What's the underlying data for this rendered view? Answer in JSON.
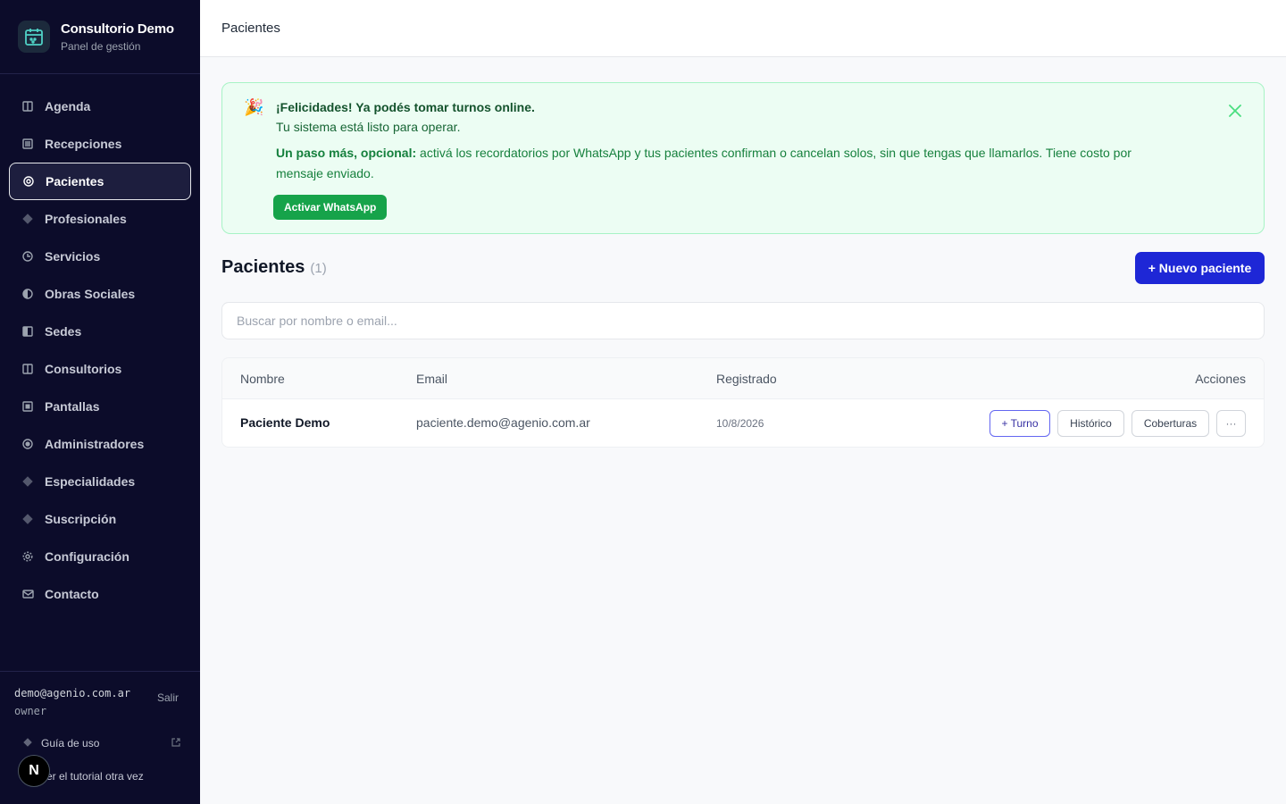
{
  "brand": {
    "title": "Consultorio Demo",
    "subtitle": "Panel de gestión"
  },
  "sidebar": {
    "items": [
      {
        "label": "Agenda",
        "icon": "columns-icon"
      },
      {
        "label": "Recepciones",
        "icon": "list-icon"
      },
      {
        "label": "Pacientes",
        "icon": "target-icon",
        "active": true
      },
      {
        "label": "Profesionales",
        "icon": "diamond-icon"
      },
      {
        "label": "Servicios",
        "icon": "clock-icon"
      },
      {
        "label": "Obras Sociales",
        "icon": "half-circle-icon"
      },
      {
        "label": "Sedes",
        "icon": "half-square-icon"
      },
      {
        "label": "Consultorios",
        "icon": "columns-icon"
      },
      {
        "label": "Pantallas",
        "icon": "screen-icon"
      },
      {
        "label": "Administradores",
        "icon": "record-icon"
      },
      {
        "label": "Especialidades",
        "icon": "diamond-icon"
      },
      {
        "label": "Suscripción",
        "icon": "diamond-icon"
      },
      {
        "label": "Configuración",
        "icon": "gear-icon"
      },
      {
        "label": "Contacto",
        "icon": "mail-icon"
      }
    ]
  },
  "user": {
    "email": "demo@agenio.com.ar",
    "role": "owner",
    "logout": "Salir"
  },
  "footer": {
    "guide": "Guía de uso",
    "tutorial": "er el tutorial otra vez",
    "badge": "N"
  },
  "topbar": {
    "title": "Pacientes"
  },
  "banner": {
    "emoji": "🎉",
    "title": "¡Felicidades! Ya podés tomar turnos online.",
    "line1": "Tu sistema está listo para operar.",
    "line2_bold": "Un paso más, opcional:",
    "line2_rest": " activá los recordatorios por WhatsApp y tus pacientes confirman o cancelan solos, sin que tengas que llamarlos. Tiene costo por mensaje enviado.",
    "button": "Activar WhatsApp"
  },
  "section": {
    "title": "Pacientes",
    "count": "(1)",
    "new_button": "+ Nuevo paciente"
  },
  "search": {
    "placeholder": "Buscar por nombre o email..."
  },
  "table": {
    "headers": {
      "name": "Nombre",
      "email": "Email",
      "registered": "Registrado",
      "actions": "Acciones"
    },
    "rows": [
      {
        "name": "Paciente Demo",
        "email": "paciente.demo@agenio.com.ar",
        "registered": "10/8/2026"
      }
    ],
    "actions": {
      "turno": "+ Turno",
      "historico": "Histórico",
      "coberturas": "Coberturas",
      "more": "···"
    }
  },
  "colors": {
    "sidebar_bg": "#0c0c2a",
    "accent": "#1e27d6",
    "success": "#16a34a",
    "banner_bg": "#ecfdf3"
  }
}
